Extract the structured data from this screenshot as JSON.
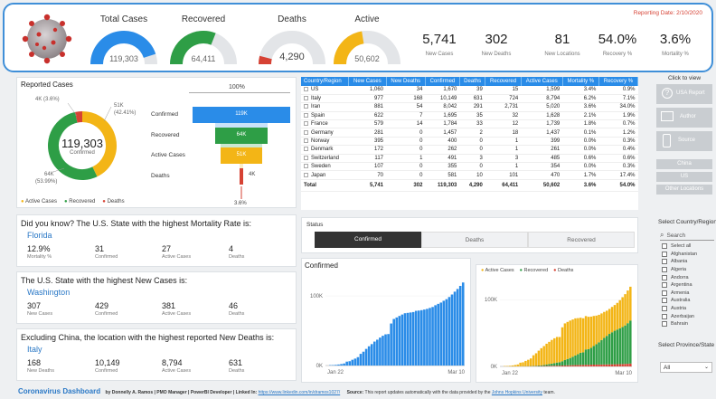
{
  "header": {
    "reporting_date": "Reporting Date: 2/10/2020",
    "gauges": [
      {
        "label": "Total Cases",
        "value": "119,303",
        "color": "#2a8ce8",
        "fill": 0.9
      },
      {
        "label": "Recovered",
        "value": "64,411",
        "color": "#2e9e46",
        "fill": 0.62
      },
      {
        "label": "Deaths",
        "value": "4,290",
        "color": "#d64234",
        "fill": 0.08
      },
      {
        "label": "Active",
        "value": "50,602",
        "color": "#f3b516",
        "fill": 0.45
      }
    ],
    "kpis": [
      {
        "value": "5,741",
        "label": "New Cases"
      },
      {
        "value": "302",
        "label": "New Deaths"
      },
      {
        "value": "81",
        "label": "New Locations"
      },
      {
        "value": "54.0%",
        "label": "Recovery %"
      },
      {
        "value": "3.6%",
        "label": "Mortality %"
      }
    ]
  },
  "reported": {
    "title": "Reported Cases",
    "center_value": "119,303",
    "center_label": "Confirmed",
    "slices": [
      {
        "name": "Active Cases",
        "value": 51,
        "color": "#f3b516"
      },
      {
        "name": "Recovered",
        "value": 64,
        "color": "#2e9e46"
      },
      {
        "name": "Deaths",
        "value": 4,
        "color": "#d64234"
      }
    ],
    "labels": {
      "deaths": "4K (3.6%)",
      "active_v": "51K",
      "active_p": "(42.41%)",
      "rec_v": "64K",
      "rec_p": "(53.99%)"
    },
    "legend": [
      "Active Cases",
      "Recovered",
      "Deaths"
    ]
  },
  "funnel": {
    "top": "100%",
    "bottom": "3.6%",
    "rows": [
      {
        "label": "Confirmed",
        "value": "119K",
        "frac": 1.0,
        "color": "#2a8ce8"
      },
      {
        "label": "Recovered",
        "value": "64K",
        "frac": 0.54,
        "color": "#2e9e46"
      },
      {
        "label": "Active Cases",
        "value": "51K",
        "frac": 0.42,
        "color": "#f3b516"
      },
      {
        "label": "Deaths",
        "value": "4K",
        "frac": 0.036,
        "color": "#d64234"
      }
    ]
  },
  "grid": {
    "headers": [
      "Country/Region",
      "New Cases",
      "New Deaths",
      "Confirmed",
      "Deaths",
      "Recovered",
      "Active Cases",
      "Mortality %",
      "Recovery %"
    ],
    "rows": [
      [
        "US",
        "1,060",
        "34",
        "1,670",
        "39",
        "15",
        "1,599",
        "3.4%",
        "0.9%"
      ],
      [
        "Italy",
        "977",
        "168",
        "10,149",
        "631",
        "724",
        "8,794",
        "6.2%",
        "7.1%"
      ],
      [
        "Iran",
        "881",
        "54",
        "8,042",
        "291",
        "2,731",
        "5,020",
        "3.6%",
        "34.0%"
      ],
      [
        "Spain",
        "622",
        "7",
        "1,695",
        "35",
        "32",
        "1,628",
        "2.1%",
        "1.9%"
      ],
      [
        "France",
        "579",
        "14",
        "1,784",
        "33",
        "12",
        "1,739",
        "1.8%",
        "0.7%"
      ],
      [
        "Germany",
        "281",
        "0",
        "1,457",
        "2",
        "18",
        "1,437",
        "0.1%",
        "1.2%"
      ],
      [
        "Norway",
        "395",
        "0",
        "400",
        "0",
        "1",
        "399",
        "0.0%",
        "0.3%"
      ],
      [
        "Denmark",
        "172",
        "0",
        "262",
        "0",
        "1",
        "261",
        "0.0%",
        "0.4%"
      ],
      [
        "Switzerland",
        "117",
        "1",
        "491",
        "3",
        "3",
        "485",
        "0.6%",
        "0.6%"
      ],
      [
        "Sweden",
        "107",
        "0",
        "355",
        "0",
        "1",
        "354",
        "0.0%",
        "0.3%"
      ],
      [
        "Japan",
        "70",
        "0",
        "581",
        "10",
        "101",
        "470",
        "1.7%",
        "17.4%"
      ]
    ],
    "total": [
      "Total",
      "5,741",
      "302",
      "119,303",
      "4,290",
      "64,411",
      "50,602",
      "3.6%",
      "54.0%"
    ]
  },
  "side": {
    "title": "Click to view",
    "buttons": [
      "USA Report",
      "Author",
      "Source"
    ],
    "filters": [
      "China",
      "US",
      "Other Locations"
    ]
  },
  "facts": [
    {
      "title": "Did you know? The U.S. State with the highest Mortality Rate is:",
      "location": "Florida",
      "stats": [
        {
          "v": "12.9%",
          "l": "Mortality %"
        },
        {
          "v": "31",
          "l": "Confirmed"
        },
        {
          "v": "27",
          "l": "Active Cases"
        },
        {
          "v": "4",
          "l": "Deaths"
        }
      ]
    },
    {
      "title": "The U.S. State with the highest New Cases is:",
      "location": "Washington",
      "stats": [
        {
          "v": "307",
          "l": "New Cases"
        },
        {
          "v": "429",
          "l": "Confirmed"
        },
        {
          "v": "381",
          "l": "Active Cases"
        },
        {
          "v": "46",
          "l": "Deaths"
        }
      ]
    },
    {
      "title": "Excluding China, the location with the highest reported New Deaths is:",
      "location": "Italy",
      "stats": [
        {
          "v": "168",
          "l": "New Deaths"
        },
        {
          "v": "10,149",
          "l": "Confirmed"
        },
        {
          "v": "8,794",
          "l": "Active Cases"
        },
        {
          "v": "631",
          "l": "Deaths"
        }
      ]
    }
  ],
  "status": {
    "label": "Status",
    "tabs": [
      "Confirmed",
      "Deaths",
      "Recovered"
    ],
    "active": 0
  },
  "filters": {
    "country_title": "Select Country/Region",
    "search_placeholder": "Search",
    "countries": [
      "Select all",
      "Afghanistan",
      "Albania",
      "Algeria",
      "Andorra",
      "Argentina",
      "Armenia",
      "Australia",
      "Austria",
      "Azerbaijan",
      "Bahrain"
    ],
    "province_title": "Select Province/State",
    "province_value": "All"
  },
  "footer": {
    "title": "Coronavirus Dashboard",
    "by": "by Donnelly A. Ramos | PMO Manager | PowerBI Developer | Linked In:",
    "link": "https://www.linkedin.com/in/dramos1027/",
    "source_label": "Source:",
    "source_text": "This report updates automatically with the data provided by the",
    "source_link": "Johns Hopkins University",
    "source_end": "team."
  },
  "chart_data": [
    {
      "type": "bar",
      "title": "Confirmed",
      "x_start": "Jan 22",
      "x_end": "Mar 10",
      "yticks": [
        "0K",
        "100K"
      ],
      "ylim": [
        0,
        130000
      ],
      "series": [
        {
          "name": "Confirmed",
          "color": "#2a8ce8",
          "values": [
            555,
            654,
            941,
            1434,
            2118,
            2927,
            5578,
            6166,
            8234,
            9927,
            12038,
            16787,
            19881,
            23892,
            27635,
            30794,
            34391,
            37120,
            40150,
            42762,
            44802,
            45221,
            60368,
            66885,
            69030,
            71224,
            73258,
            75136,
            75639,
            76197,
            76819,
            78572,
            78958,
            79561,
            80406,
            81388,
            82746,
            84112,
            86604,
            88585,
            90443,
            93016,
            95314,
            98425,
            102050,
            106099,
            109991,
            114381,
            119303
          ]
        }
      ]
    },
    {
      "type": "area",
      "title": "",
      "x_start": "Jan 22",
      "x_end": "Mar 10",
      "yticks": [
        "0K",
        "100K"
      ],
      "ylim": [
        0,
        130000
      ],
      "series": [
        {
          "name": "Active Cases",
          "color": "#f3b516",
          "values": [
            510,
            605,
            879,
            1352,
            2011,
            2795,
            5353,
            5896,
            7930,
            9488,
            11431,
            15876,
            18633,
            22237,
            25613,
            28327,
            31244,
            33343,
            35492,
            37174,
            38310,
            37784,
            50900,
            54828,
            55542,
            56020,
            55819,
            55601,
            54062,
            52462,
            50946,
            50039,
            48422,
            46700,
            44921,
            42887,
            41187,
            39747,
            38862,
            37697,
            37378,
            38002,
            38526,
            39927,
            42153,
            44642,
            46806,
            48917,
            50602
          ]
        },
        {
          "name": "Recovered",
          "color": "#2e9e46",
          "values": [
            28,
            30,
            36,
            39,
            52,
            61,
            107,
            126,
            143,
            222,
            284,
            472,
            623,
            852,
            1124,
            1487,
            2011,
            2616,
            3244,
            3946,
            4683,
            5150,
            6295,
            8058,
            9395,
            10865,
            12583,
            14352,
            16121,
            18177,
            18890,
            22886,
            23394,
            25227,
            27905,
            30384,
            33277,
            36711,
            39782,
            42716,
            45602,
            47938,
            50134,
            51828,
            53520,
            55447,
            57545,
            60710,
            64411
          ]
        },
        {
          "name": "Deaths",
          "color": "#d64234",
          "values": [
            17,
            18,
            26,
            42,
            56,
            82,
            131,
            133,
            171,
            213,
            259,
            362,
            426,
            492,
            564,
            634,
            719,
            806,
            906,
            1013,
            1113,
            1118,
            1371,
            1523,
            1666,
            1770,
            1868,
            2007,
            2122,
            2247,
            2251,
            2458,
            2469,
            2629,
            2708,
            2770,
            2814,
            2872,
            2941,
            2996,
            3085,
            3160,
            3254,
            3348,
            3460,
            3558,
            3803,
            3996,
            4290
          ]
        }
      ]
    }
  ]
}
